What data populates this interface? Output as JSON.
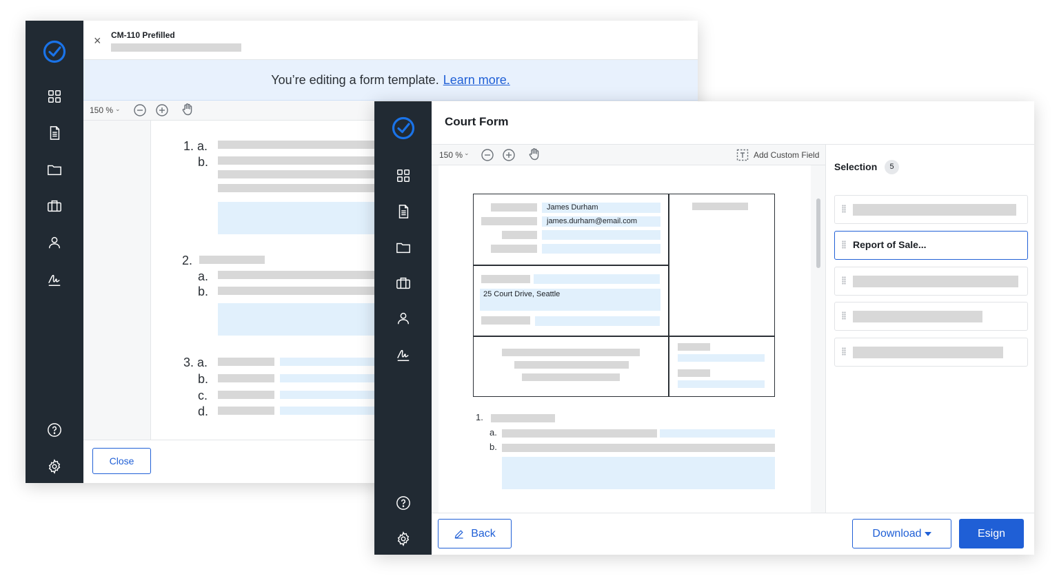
{
  "back_window": {
    "title": "CM-110 Prefilled",
    "banner_text": "You’re editing a form template.",
    "banner_link": "Learn more.",
    "zoom": "150 %",
    "item_labels": [
      "1. a.",
      "b.",
      "2.",
      "a.",
      "b.",
      "3. a.",
      "b.",
      "c.",
      "d."
    ],
    "close_label": "Close"
  },
  "front_window": {
    "title": "Court Form",
    "zoom": "150 %",
    "add_custom_field": "Add Custom Field",
    "form": {
      "name_value": "James Durham",
      "email_value": "james.durham@email.com",
      "address_value": "25 Court Drive, Seattle",
      "item_labels": [
        "1.",
        "a.",
        "b."
      ]
    },
    "selection": {
      "title": "Selection",
      "count": "5",
      "active_item": "Report of Sale..."
    },
    "back_label": "Back",
    "download_label": "Download",
    "esign_label": "Esign"
  },
  "icons": {
    "logo": "check-circle-logo",
    "sidebar": [
      "grid-icon",
      "document-icon",
      "folder-icon",
      "briefcase-icon",
      "user-icon",
      "signature-icon",
      "help-icon",
      "gear-icon"
    ],
    "toolbar": [
      "zoom-out-icon",
      "zoom-in-icon",
      "pan-hand-icon"
    ]
  },
  "colors": {
    "sidebar": "#212a33",
    "accent": "#1f5fd6",
    "banner": "#e8f1fd",
    "field": "#e1f0fc",
    "placeholder": "#d8d8d8"
  }
}
